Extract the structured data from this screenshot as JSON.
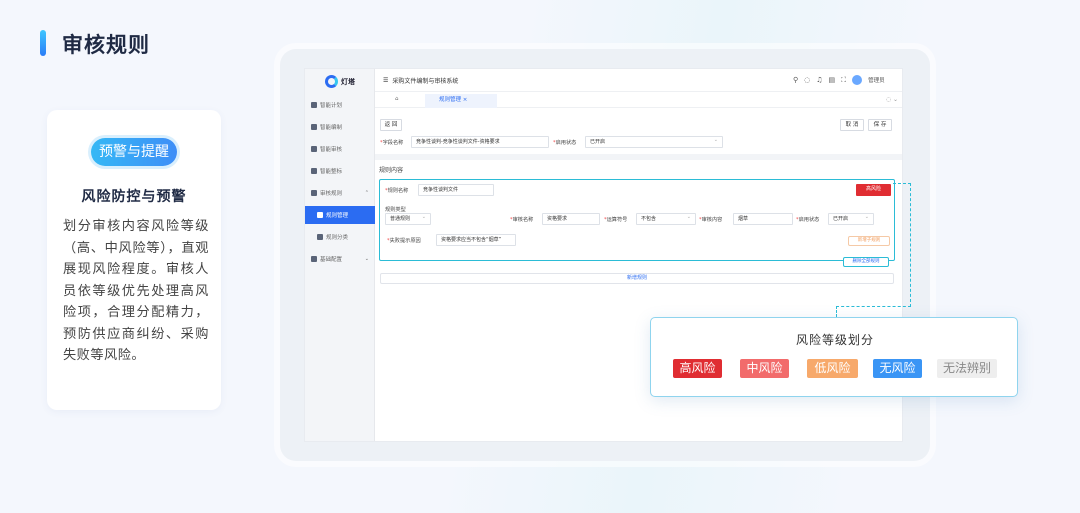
{
  "page": {
    "heading": "审核规则"
  },
  "card": {
    "badge": "预警与提醒",
    "title": "风险防控与预警",
    "desc": "划分审核内容风险等级（高、中风险等），直观展现风险程度。审核人员依等级优先处理高风险项，合理分配精力，预防供应商纠纷、采购失败等风险。"
  },
  "app": {
    "logo": "灯塔",
    "window_title": "采购文件编制与审核系统",
    "user": "管理员",
    "sidebar": [
      {
        "label": "智能计划"
      },
      {
        "label": "智能编制"
      },
      {
        "label": "智能审核"
      },
      {
        "label": "智能整标"
      },
      {
        "label": "审核规则"
      },
      {
        "label": "规则管理"
      },
      {
        "label": "规则分类"
      },
      {
        "label": "基础配置"
      }
    ],
    "tabs": {
      "home": "⌂",
      "active": "规则管理 ×"
    },
    "toolbar": {
      "back": "返 回",
      "cancel": "取 消",
      "save": "保 存"
    },
    "form": {
      "field_label": "字段名称",
      "field_value": "竞争性谈判-竞争性谈判文件-资格要求",
      "status_label": "启用状态",
      "status_value": "已开启",
      "section_title": "规则内容",
      "rule_name_label": "规则名称",
      "rule_name_value": "竞争性谈判文件",
      "risk_tag": "高风险",
      "rule_type_label": "规则类型",
      "rule_type_value": "普通规则",
      "review_name_label": "审核名称",
      "review_name_value": "资格要求",
      "operator_label": "运算符号",
      "operator_value": "不包含",
      "content_label": "审核内容",
      "content_value": "烟草",
      "enable_label": "启用状态",
      "enable_value": "已开启",
      "fail_label": "失败提示原因",
      "fail_value": "资格要求应当不包含“烟草”",
      "add_sub": "新增子规则",
      "delete_all": "删除全部规则",
      "add_rule": "新增规则"
    }
  },
  "popup": {
    "title": "风险等级划分",
    "levels": [
      {
        "label": "高风险",
        "color": "#e02d32"
      },
      {
        "label": "中风险",
        "color": "#f26b6b"
      },
      {
        "label": "低风险",
        "color": "#f7a96b"
      },
      {
        "label": "无风险",
        "color": "#3a95f5"
      },
      {
        "label": "无法辨别",
        "color": "#eeeeee"
      }
    ]
  }
}
